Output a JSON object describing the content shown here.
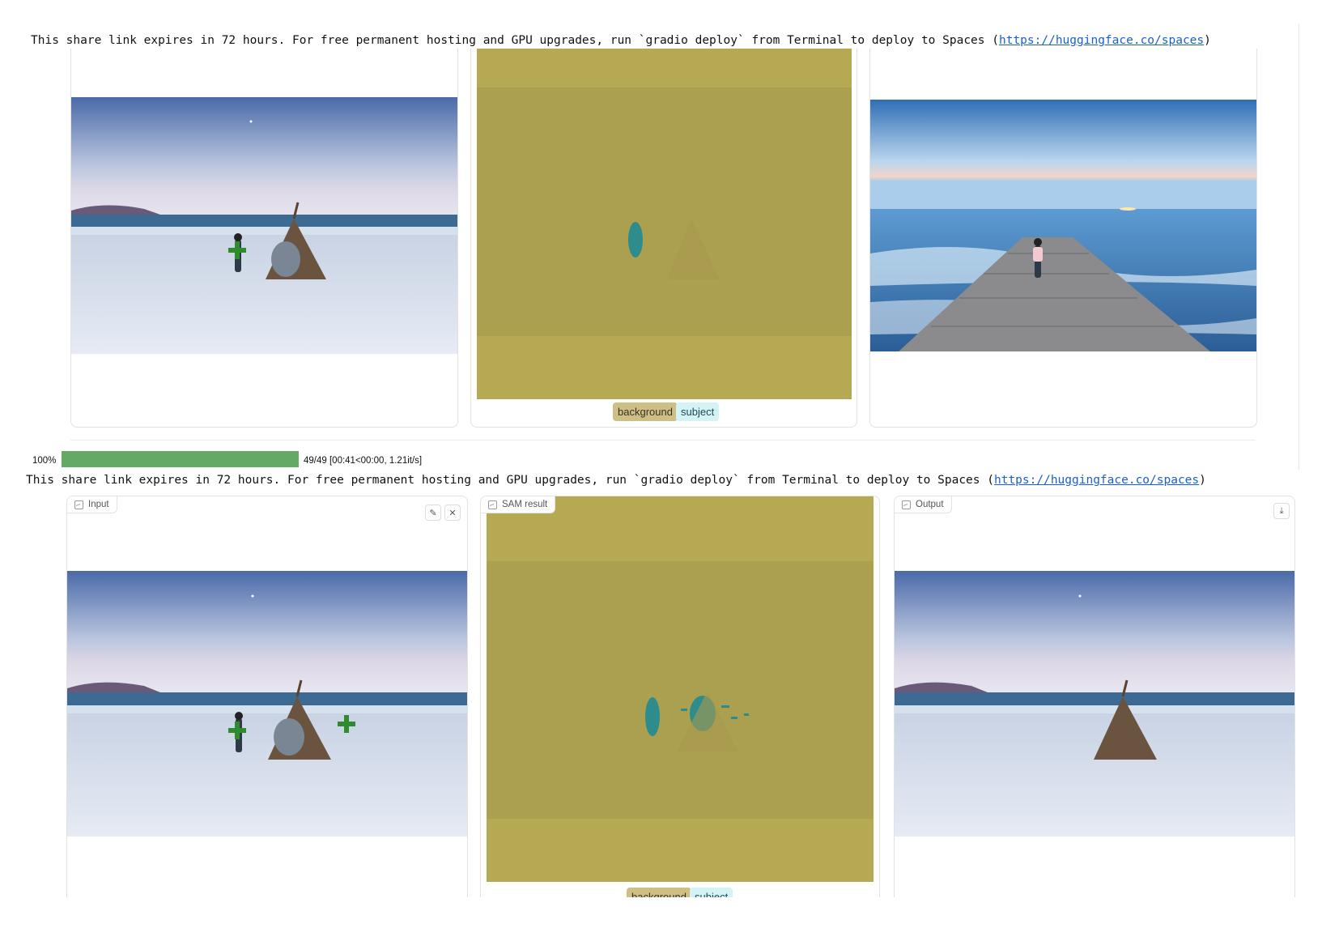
{
  "share_notice": {
    "text": "This share link expires in 72 hours. For free permanent hosting and GPU upgrades, run `gradio deploy` from Terminal to deploy to Spaces (",
    "link": "https://huggingface.co/spaces",
    "close": ")"
  },
  "top_run": {
    "legend": {
      "background": "background",
      "subject": "subject"
    }
  },
  "progress": {
    "percent_label": "100%",
    "percent_value": 100,
    "info": "49/49 [00:41<00:00,  1.21it/s]"
  },
  "bottom_run": {
    "input_label": "Input",
    "sam_label": "SAM result",
    "output_label": "Output",
    "legend": {
      "background": "background",
      "subject": "subject"
    }
  },
  "icons": [
    "image-icon",
    "pencil-icon",
    "close-icon",
    "download-icon",
    "plus-marker-icon"
  ],
  "colors": {
    "mask": "#b5a954",
    "progress": "#64a964",
    "link": "#1a5fd1",
    "point_marker": "#2e8b2e"
  }
}
